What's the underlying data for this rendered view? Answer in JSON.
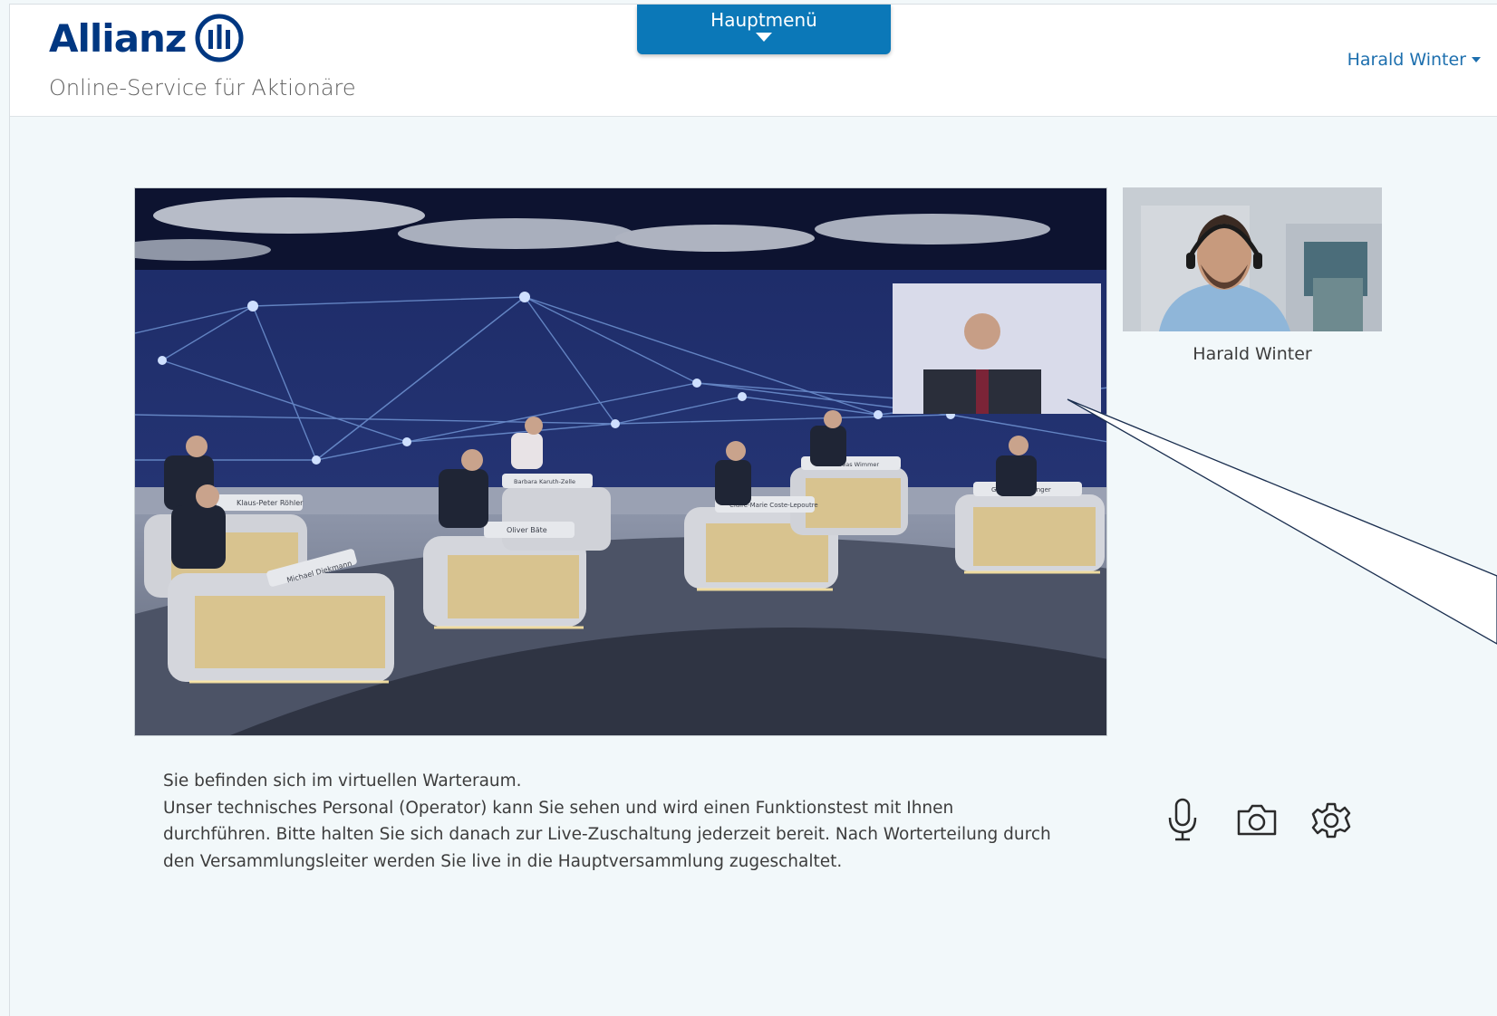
{
  "header": {
    "logo_text": "Allianz",
    "subtitle": "Online-Service für Aktionäre",
    "menu_label": "Hauptmenü",
    "user_name": "Harald Winter"
  },
  "video": {
    "self_name": "Harald Winter",
    "nameplates": [
      "Klaus-Peter Röhler",
      "Michael Diekmann",
      "Oliver Bäte",
      "Barbara Karuth-Zelle",
      "Claire-Marie Coste-Lepoutre",
      "Andreas Wimmer",
      "Günther Thallinger"
    ]
  },
  "message": {
    "line1": "Sie befinden sich im virtuellen Warteraum.",
    "line2": "Unser technisches Personal (Operator) kann Sie sehen und wird einen Funktionstest mit Ihnen durchführen. Bitte halten Sie sich danach zur Live-Zuschaltung jederzeit bereit. Nach Worterteilung durch den Versammlungsleiter werden Sie live in die Hauptversammlung zugeschaltet."
  },
  "controls": {
    "icons": [
      "microphone-icon",
      "camera-icon",
      "settings-gear-icon"
    ]
  },
  "colors": {
    "brand": "#003781",
    "accent": "#0b78b8",
    "link": "#1d6fae",
    "background": "#f2f8fa"
  }
}
